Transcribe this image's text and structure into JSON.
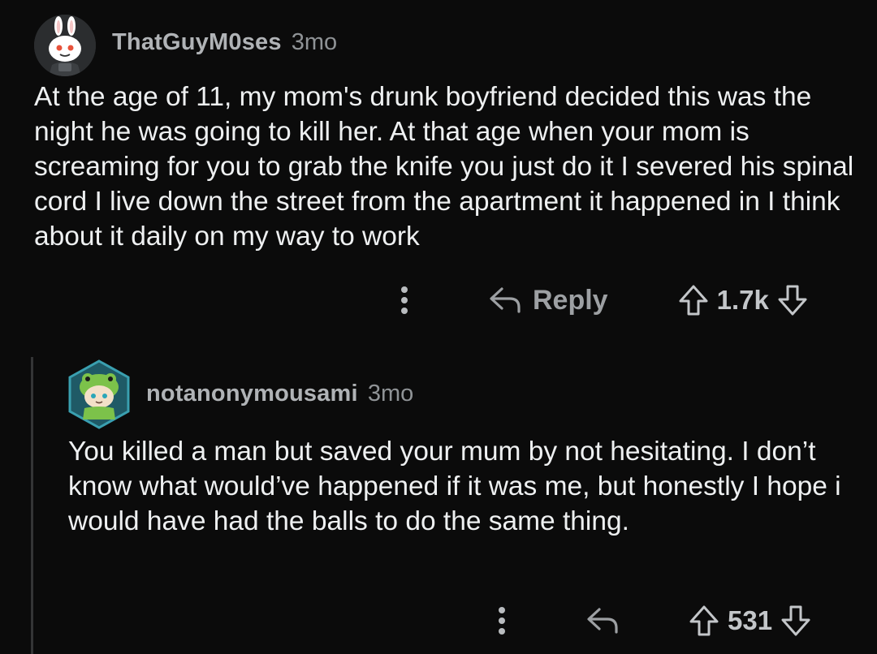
{
  "comments": [
    {
      "username": "ThatGuyM0ses",
      "age": "3mo",
      "text": "At the age of 11, my mom's drunk boyfriend decided this was the night he was going to kill her. At that age when your mom is screaming for you to grab the knife you just do it I severed his spinal cord I live down the street from the apartment it happened in I think about it daily on my way to work",
      "reply_label": "Reply",
      "score": "1.7k"
    },
    {
      "username": "notanonymousami",
      "age": "3mo",
      "text": "You killed a man but saved your mum by not hesitating. I don’t know what would’ve happened if it was me, but honestly I hope i would have had the balls to do the same thing.",
      "score": "531"
    }
  ],
  "icons": {
    "more": "more-vertical-icon",
    "reply": "reply-arrow-icon",
    "upvote": "upvote-arrow-icon",
    "downvote": "downvote-arrow-icon"
  },
  "colors": {
    "background": "#0b0b0b",
    "text": "#eef0f1",
    "meta": "#8f9396",
    "action": "#9da0a3"
  }
}
